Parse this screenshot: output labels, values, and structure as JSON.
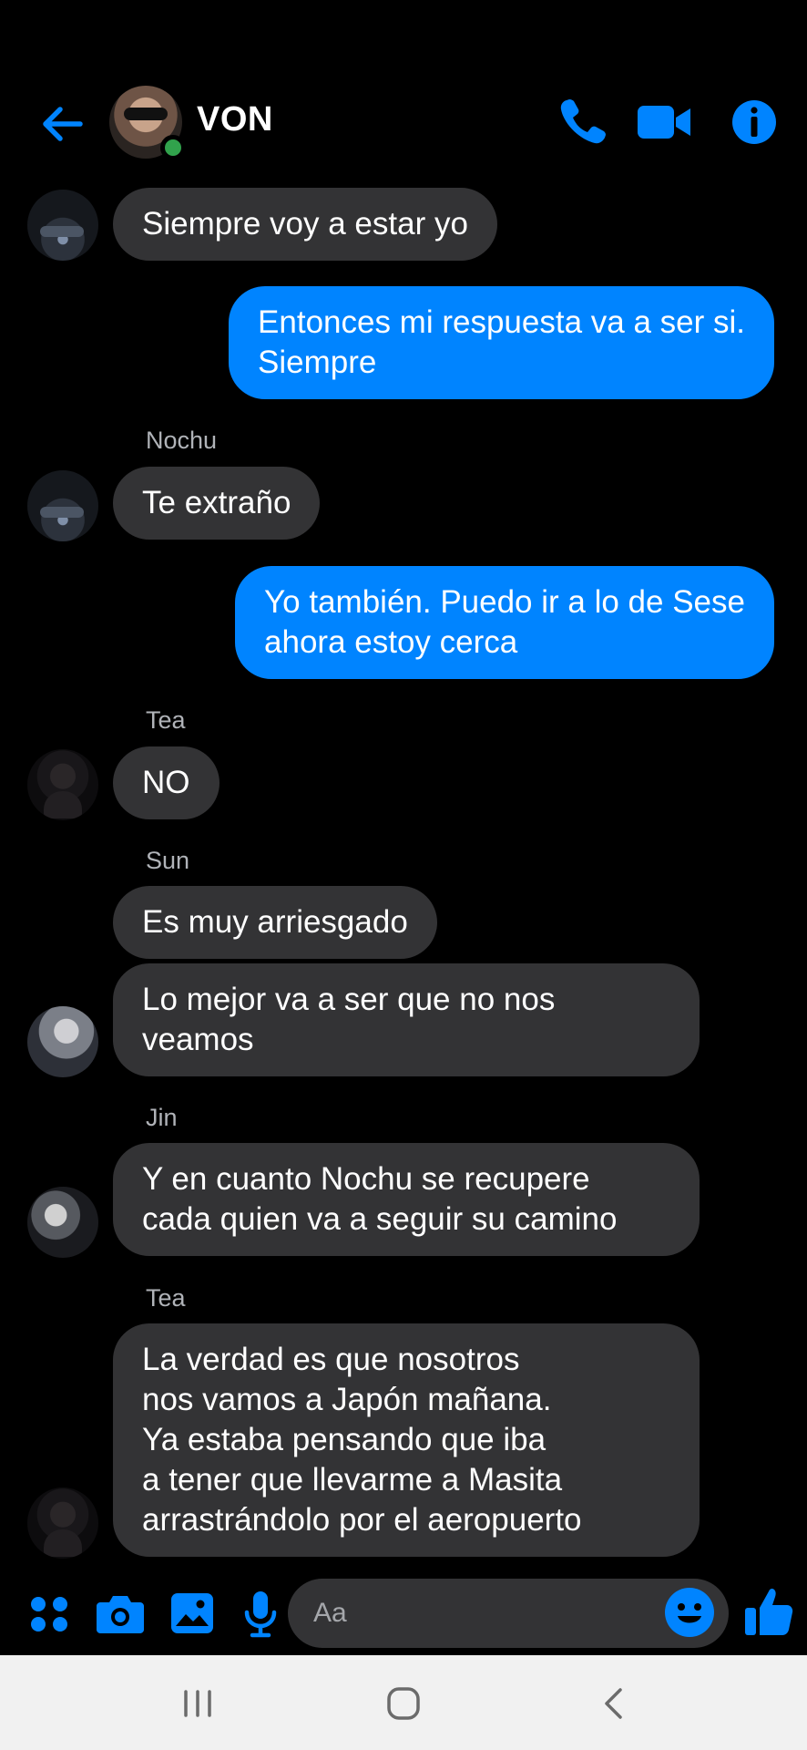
{
  "header": {
    "title": "VON",
    "back_icon": "arrow-left-icon",
    "call_icon": "phone-icon",
    "video_icon": "video-camera-icon",
    "info_icon": "info-icon",
    "accent": "#0084ff",
    "online_color": "#31a24c"
  },
  "messages": [
    {
      "sender": "",
      "text": "Siempre voy a estar yo",
      "direction": "incoming"
    },
    {
      "sender": "",
      "text": "Entonces mi respuesta va a ser si.\nSiempre",
      "direction": "outgoing"
    },
    {
      "sender": "Nochu",
      "text": "Te extraño",
      "direction": "incoming"
    },
    {
      "sender": "",
      "text": "Yo también. Puedo ir a lo de Sese\nahora estoy cerca",
      "direction": "outgoing"
    },
    {
      "sender": "Tea",
      "text": "NO",
      "direction": "incoming"
    },
    {
      "sender": "Sun",
      "text": "Es muy arriesgado",
      "direction": "incoming"
    },
    {
      "sender": "",
      "text": "Lo mejor va a ser que no nos\nveamos",
      "direction": "incoming"
    },
    {
      "sender": "Jin",
      "text": "Y en cuanto Nochu se recupere\ncada quien va a seguir su camino",
      "direction": "incoming"
    },
    {
      "sender": "Tea",
      "text": "La verdad es que nosotros\nnos vamos a Japón mañana.\nYa estaba pensando que iba\na tener que llevarme a Masita\narrastrándolo por el aeropuerto",
      "direction": "incoming"
    }
  ],
  "composer": {
    "placeholder": "Aa",
    "icons": [
      "apps-grid-icon",
      "camera-icon",
      "gallery-icon",
      "microphone-icon",
      "emoji-icon",
      "thumbs-up-icon"
    ]
  },
  "navbar": {
    "icons": [
      "recent-apps-icon",
      "home-icon",
      "back-icon"
    ]
  },
  "colors": {
    "background": "#000000",
    "incoming_bubble": "#333335",
    "outgoing_bubble": "#0084ff",
    "sender_label": "#b0b3b8"
  }
}
